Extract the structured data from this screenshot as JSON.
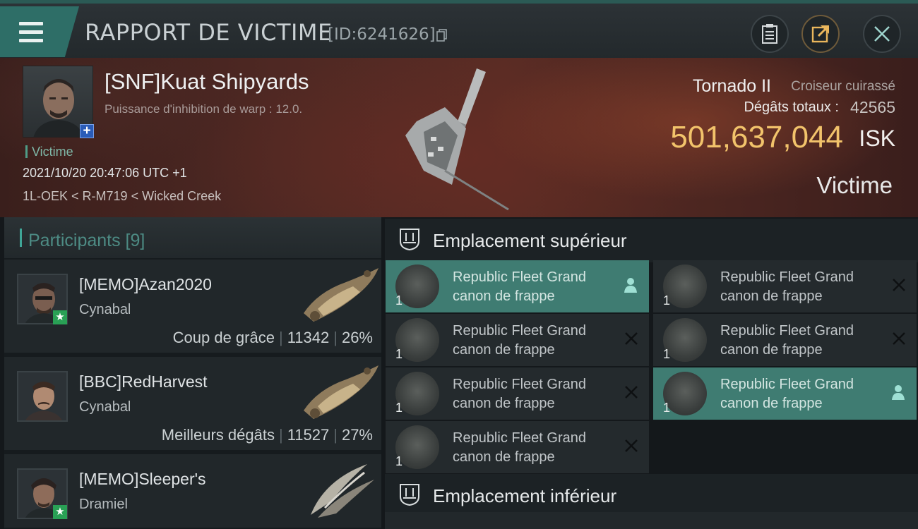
{
  "header": {
    "title": "RAPPORT DE VICTIME",
    "id_label": "[ID:6241626]",
    "icons": [
      "menu-icon",
      "copy-icon",
      "clipboard-icon",
      "share-icon",
      "close-icon"
    ]
  },
  "victim": {
    "name": "[SNF]Kuat Shipyards",
    "subtitle": "Puissance d'inhibition de warp : 12.0.",
    "role": "Victime",
    "datetime": "2021/10/20 20:47:06 UTC +1",
    "location": "1L-OEK < R-M719 < Wicked Creek",
    "ship_name": "Tornado II",
    "ship_class": "Croiseur cuirassé",
    "damage_label": "Dégâts totaux :",
    "damage_value": "42565",
    "isk_value": "501,637,044",
    "isk_unit": "ISK",
    "tag": "Victime"
  },
  "participants": {
    "title": "Participants [9]",
    "items": [
      {
        "name": "[MEMO]Azan2020",
        "ship": "Cynabal",
        "label": "Coup de grâce",
        "damage": "11342",
        "percent": "26%"
      },
      {
        "name": "[BBC]RedHarvest",
        "ship": "Cynabal",
        "label": "Meilleurs dégâts",
        "damage": "11527",
        "percent": "27%"
      },
      {
        "name": "[MEMO]Sleeper's",
        "ship": "Dramiel",
        "label": "",
        "damage": "",
        "percent": ""
      }
    ]
  },
  "slots": {
    "high_title": "Emplacement supérieur",
    "low_title": "Emplacement inférieur",
    "items": [
      {
        "line1": "Republic Fleet Grand",
        "line2": "canon de frappe",
        "qty": "1",
        "state": "person-icon"
      },
      {
        "line1": "Republic Fleet Grand",
        "line2": "canon de frappe",
        "qty": "1",
        "state": "x-icon"
      },
      {
        "line1": "Republic Fleet Grand",
        "line2": "canon de frappe",
        "qty": "1",
        "state": "x-icon"
      },
      {
        "line1": "Republic Fleet Grand",
        "line2": "canon de frappe",
        "qty": "1",
        "state": "x-icon"
      },
      {
        "line1": "Republic Fleet Grand",
        "line2": "canon de frappe",
        "qty": "1",
        "state": "x-icon"
      },
      {
        "line1": "Republic Fleet Grand",
        "line2": "canon de frappe",
        "qty": "1",
        "state": "person-icon"
      },
      {
        "line1": "Republic Fleet Grand",
        "line2": "canon de frappe",
        "qty": "1",
        "state": "x-icon"
      }
    ]
  },
  "colors": {
    "accent": "#3f7c72",
    "isk": "#f2c36b",
    "badge_green": "#29a055",
    "badge_blue": "#2a5cb8"
  }
}
